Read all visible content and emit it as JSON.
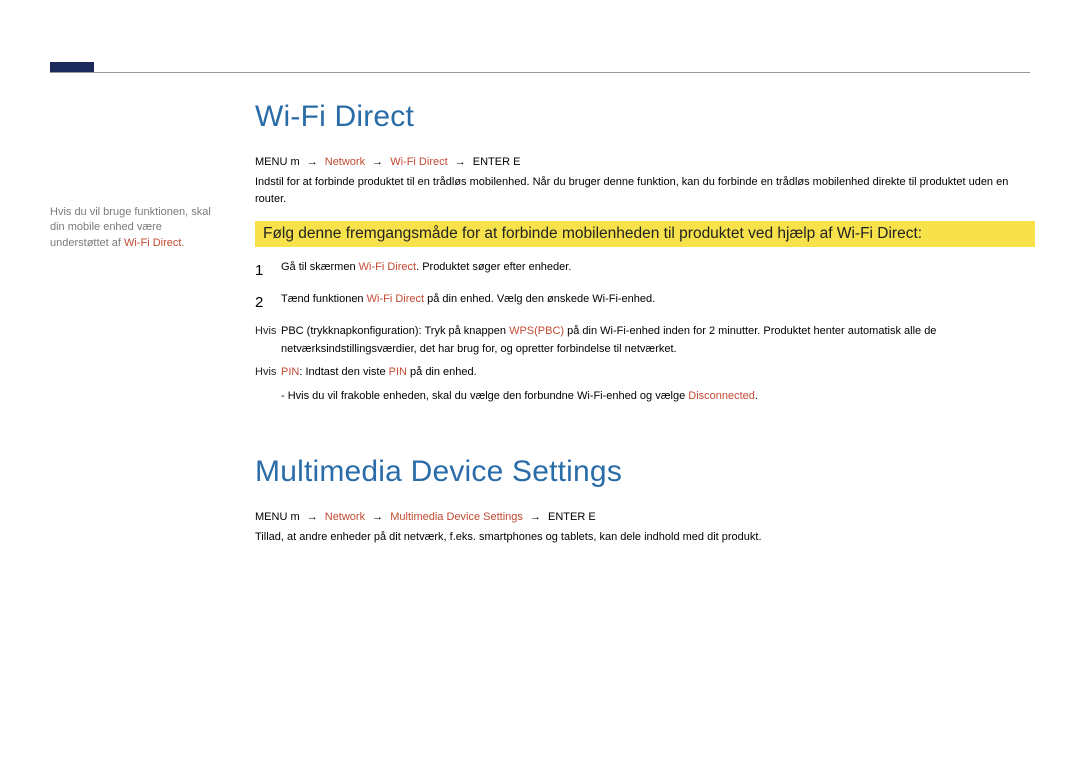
{
  "sidebar": {
    "note_prefix": "Hvis du vil bruge funktionen, skal din mobile enhed være understøttet af ",
    "note_highlight": "Wi-Fi Direct",
    "note_suffix": "."
  },
  "section1": {
    "title": "Wi-Fi Direct",
    "breadcrumb": {
      "menu": "MENU",
      "m": "m",
      "nav1": "Network",
      "nav2": "Wi-Fi Direct",
      "enter": "ENTER",
      "e": "E"
    },
    "desc": "Indstil for at forbinde produktet til en trådløs mobilenhed. Når du bruger denne funktion, kan du forbinde en trådløs mobilenhed direkte til produktet uden en router.",
    "callout": "Følg denne fremgangsmåde for at forbinde mobilenheden til produktet ved hjælp af Wi-Fi Direct:",
    "step1": {
      "num": "1",
      "pre": "Gå til skærmen ",
      "accent": "Wi-Fi Direct",
      "post": ". Produktet søger efter enheder."
    },
    "step2": {
      "num": "2",
      "pre": "Tænd funktionen ",
      "accent": "Wi-Fi Direct",
      "post": " på din enhed. Vælg den ønskede Wi-Fi-enhed."
    },
    "sub_pbc": {
      "label": "Hvis",
      "pre": "PBC (trykknapkonfiguration): Tryk på knappen ",
      "accent": "WPS(PBC)",
      "post": " på din Wi-Fi-enhed inden for 2 minutter. Produktet henter automatisk alle de netværksindstillingsværdier, det har brug for, og opretter forbindelse til netværket."
    },
    "sub_pin": {
      "label": "Hvis",
      "pre": "PIN",
      "mid": ": Indtast den viste ",
      "accent": "PIN",
      "post": " på din enhed."
    },
    "note": {
      "pre": "Hvis du vil frakoble enheden, skal du vælge den forbundne Wi-Fi-enhed og vælge ",
      "accent": "Disconnected",
      "post": "."
    }
  },
  "section2": {
    "title": "Multimedia Device Settings",
    "breadcrumb": {
      "menu": "MENU",
      "m": "m",
      "nav1": "Network",
      "nav2": "Multimedia Device Settings",
      "enter": "ENTER",
      "e": "E"
    },
    "desc": "Tillad, at andre enheder på dit netværk, f.eks. smartphones og tablets, kan dele indhold med dit produkt."
  }
}
